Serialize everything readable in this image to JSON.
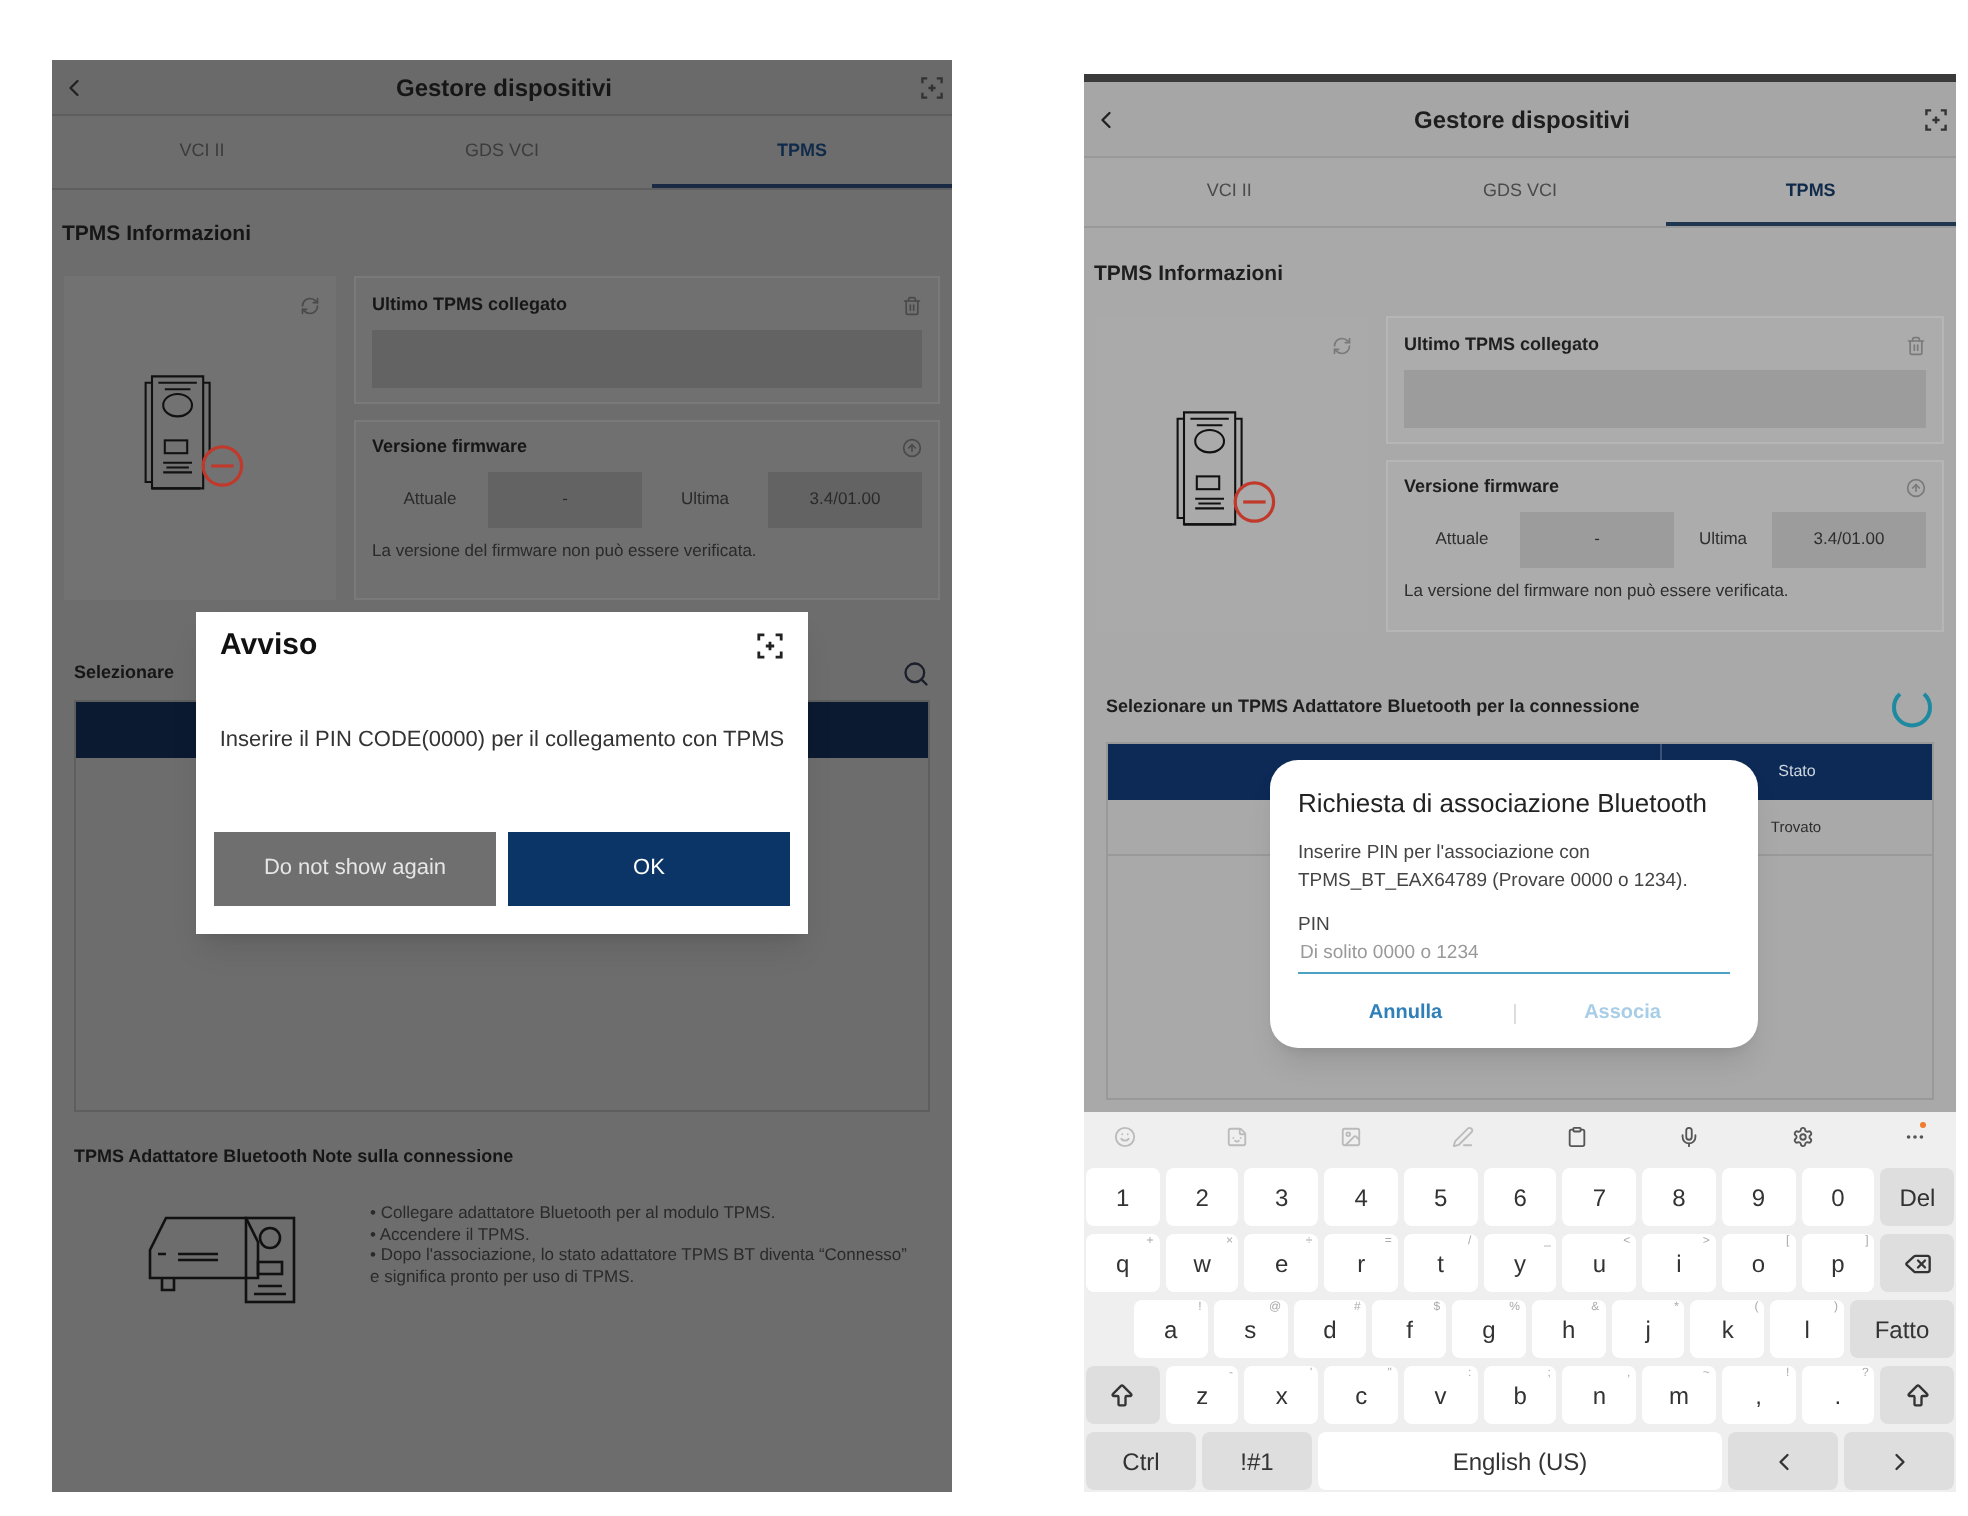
{
  "screens": [
    {
      "header": {
        "title": "Gestore dispositivi"
      },
      "tabs": [
        {
          "label": "VCI II",
          "selected": false
        },
        {
          "label": "GDS VCI",
          "selected": false
        },
        {
          "label": "TPMS",
          "selected": true
        }
      ],
      "info_title": "TPMS Informazioni",
      "last_connected": {
        "title": "Ultimo TPMS collegato"
      },
      "firmware": {
        "title": "Versione firmware",
        "current_label": "Attuale",
        "current_value": "-",
        "latest_label": "Ultima",
        "latest_value": "3.4/01.00",
        "note": "La versione del firmware non può essere verificata."
      },
      "select": {
        "title": "Selezionare",
        "kind": "search"
      },
      "notes": {
        "title": "TPMS Adattatore Bluetooth Note sulla connessione",
        "items": [
          "• Collegare adattatore Bluetooth per al modulo TPMS.",
          "• Accendere il TPMS.",
          "• Dopo l'associazione, lo stato adattatore TPMS BT diventa “Connesso” e significa pronto per uso di TPMS."
        ]
      },
      "dialog": {
        "kind": "alert",
        "title": "Avviso",
        "message": "Inserire il PIN CODE(0000) per il collegamento con TPMS",
        "buttons": [
          {
            "label": "Do not show again",
            "kind": "secondary",
            "disabled": false
          },
          {
            "label": "OK",
            "kind": "primary",
            "disabled": false
          }
        ]
      }
    },
    {
      "header": {
        "title": "Gestore dispositivi"
      },
      "tabs": [
        {
          "label": "VCI II",
          "selected": false
        },
        {
          "label": "GDS VCI",
          "selected": false
        },
        {
          "label": "TPMS",
          "selected": true
        }
      ],
      "info_title": "TPMS Informazioni",
      "last_connected": {
        "title": "Ultimo TPMS collegato"
      },
      "firmware": {
        "title": "Versione firmware",
        "current_label": "Attuale",
        "current_value": "-",
        "latest_label": "Ultima",
        "latest_value": "3.4/01.00",
        "note": "La versione del firmware non può essere verificata."
      },
      "select": {
        "title": "Selezionare un TPMS Adattatore Bluetooth per la connessione",
        "kind": "spinner"
      },
      "table": {
        "status_column": "Stato",
        "rows": [
          {
            "status": "Trovato"
          }
        ]
      },
      "dialog": {
        "kind": "pairing",
        "title": "Richiesta di associazione Bluetooth",
        "message": "Inserire PIN per l'associazione con TPMS_BT_EAX64789 (Provare 0000 o 1234).",
        "field_label": "PIN",
        "placeholder": "Di solito 0000 o 1234",
        "buttons": [
          {
            "label": "Annulla",
            "kind": "text",
            "disabled": false
          },
          {
            "label": "Associa",
            "kind": "text",
            "disabled": true
          }
        ]
      },
      "keyboard": {
        "rows": [
          {
            "keys": [
              {
                "kind": "char",
                "label": "1"
              },
              {
                "kind": "char",
                "label": "2"
              },
              {
                "kind": "char",
                "label": "3"
              },
              {
                "kind": "char",
                "label": "4"
              },
              {
                "kind": "char",
                "label": "5"
              },
              {
                "kind": "char",
                "label": "6"
              },
              {
                "kind": "char",
                "label": "7"
              },
              {
                "kind": "char",
                "label": "8"
              },
              {
                "kind": "char",
                "label": "9"
              },
              {
                "kind": "char",
                "label": "0"
              },
              {
                "kind": "function",
                "label": "Del"
              }
            ]
          },
          {
            "keys": [
              {
                "kind": "char",
                "label": "q",
                "hint": "+"
              },
              {
                "kind": "char",
                "label": "w",
                "hint": "×"
              },
              {
                "kind": "char",
                "label": "e",
                "hint": "÷"
              },
              {
                "kind": "char",
                "label": "r",
                "hint": "="
              },
              {
                "kind": "char",
                "label": "t",
                "hint": "/"
              },
              {
                "kind": "char",
                "label": "y",
                "hint": "_"
              },
              {
                "kind": "char",
                "label": "u",
                "hint": "<"
              },
              {
                "kind": "char",
                "label": "i",
                "hint": ">"
              },
              {
                "kind": "char",
                "label": "o",
                "hint": "["
              },
              {
                "kind": "char",
                "label": "p",
                "hint": "]"
              },
              {
                "kind": "backspace"
              }
            ]
          },
          {
            "keys": [
              {
                "kind": "char",
                "label": "a",
                "hint": "!"
              },
              {
                "kind": "char",
                "label": "s",
                "hint": "@"
              },
              {
                "kind": "char",
                "label": "d",
                "hint": "#"
              },
              {
                "kind": "char",
                "label": "f",
                "hint": "$"
              },
              {
                "kind": "char",
                "label": "g",
                "hint": "%"
              },
              {
                "kind": "char",
                "label": "h",
                "hint": "&"
              },
              {
                "kind": "char",
                "label": "j",
                "hint": "*"
              },
              {
                "kind": "char",
                "label": "k",
                "hint": "("
              },
              {
                "kind": "char",
                "label": "l",
                "hint": ")"
              },
              {
                "kind": "action",
                "label": "Fatto"
              }
            ]
          },
          {
            "keys": [
              {
                "kind": "shift"
              },
              {
                "kind": "char",
                "label": "z",
                "hint": "-"
              },
              {
                "kind": "char",
                "label": "x",
                "hint": "'"
              },
              {
                "kind": "char",
                "label": "c",
                "hint": "\""
              },
              {
                "kind": "char",
                "label": "v",
                "hint": ":"
              },
              {
                "kind": "char",
                "label": "b",
                "hint": ";"
              },
              {
                "kind": "char",
                "label": "n",
                "hint": ","
              },
              {
                "kind": "char",
                "label": "m",
                "hint": "~"
              },
              {
                "kind": "char",
                "label": ",",
                "hint": "!"
              },
              {
                "kind": "char",
                "label": ".",
                "hint": "?"
              },
              {
                "kind": "shift"
              }
            ]
          },
          {
            "keys": [
              {
                "kind": "function",
                "label": "Ctrl"
              },
              {
                "kind": "function",
                "label": "!#1"
              },
              {
                "kind": "space",
                "label": "English (US)"
              },
              {
                "kind": "arrow_left"
              },
              {
                "kind": "arrow_right"
              }
            ]
          }
        ]
      }
    }
  ]
}
